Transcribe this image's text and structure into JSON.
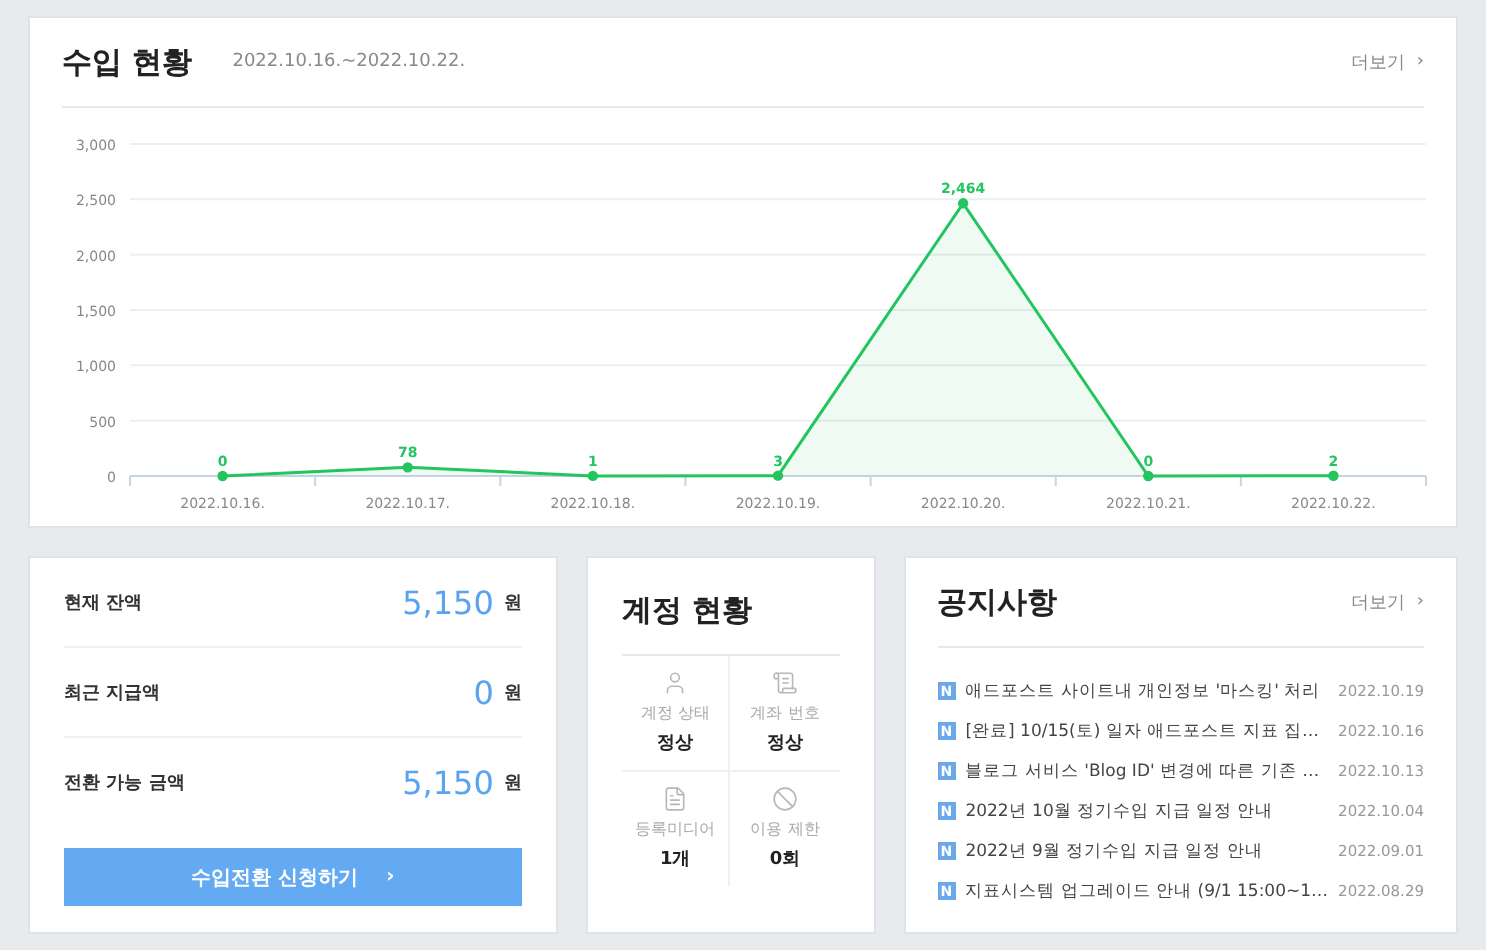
{
  "income": {
    "title": "수입 현황",
    "period": "2022.10.16.~2022.10.22.",
    "more": "더보기",
    "more_icon": "›",
    "chart_data": {
      "type": "area",
      "categories": [
        "2022.10.16.",
        "2022.10.17.",
        "2022.10.18.",
        "2022.10.19.",
        "2022.10.20.",
        "2022.10.21.",
        "2022.10.22."
      ],
      "series": [
        {
          "color": "#22c55e",
          "values": [
            0,
            78,
            1,
            3,
            2464,
            0,
            2
          ]
        }
      ],
      "grid": true,
      "ylim": [
        0,
        3000
      ],
      "yticks": [
        {
          "value": 0,
          "label": "0"
        },
        {
          "value": 500,
          "label": "500"
        },
        {
          "value": 1000,
          "label": "1,000"
        },
        {
          "value": 1500,
          "label": "1,500"
        },
        {
          "value": 2000,
          "label": "2,000"
        },
        {
          "value": 2500,
          "label": "2,500"
        },
        {
          "value": 3000,
          "label": "3,000"
        }
      ],
      "value_labels": [
        "0",
        "78",
        "1",
        "3",
        "2,464",
        "0",
        "2"
      ]
    }
  },
  "balance": {
    "rows": [
      {
        "label": "현재 잔액",
        "amount": "5,150",
        "unit": "원"
      },
      {
        "label": "최근 지급액",
        "amount": "0",
        "unit": "원"
      },
      {
        "label": "전환 가능 금액",
        "amount": "5,150",
        "unit": "원"
      }
    ],
    "button": {
      "label": "수입전환 신청하기",
      "icon": "›"
    }
  },
  "account": {
    "title": "계정 현황",
    "items": [
      {
        "kind": "user",
        "label": "계정 상태",
        "value": "정상"
      },
      {
        "kind": "account",
        "label": "계좌 번호",
        "value": "정상"
      },
      {
        "kind": "media",
        "label": "등록미디어",
        "value": "1개"
      },
      {
        "kind": "limit",
        "label": "이용 제한",
        "value": "0회"
      }
    ]
  },
  "notices": {
    "title": "공지사항",
    "more": "더보기",
    "more_icon": "›",
    "items": [
      {
        "badge": "N",
        "title": "애드포스트 사이트내 개인정보 '마스킹' 처리",
        "date": "2022.10.19"
      },
      {
        "badge": "N",
        "title": "[완료] 10/15(토) 일자 애드포스트 지표 집…",
        "date": "2022.10.16"
      },
      {
        "badge": "N",
        "title": "블로그 서비스 'Blog ID' 변경에 따른 기존 …",
        "date": "2022.10.13"
      },
      {
        "badge": "N",
        "title": "2022년 10월 정기수입 지급 일정 안내",
        "date": "2022.10.04"
      },
      {
        "badge": "N",
        "title": "2022년 9월 정기수입 지급 일정 안내",
        "date": "2022.09.01"
      },
      {
        "badge": "N",
        "title": "지표시스템 업그레이드 안내 (9/1 15:00~1…",
        "date": "2022.08.29"
      }
    ]
  }
}
